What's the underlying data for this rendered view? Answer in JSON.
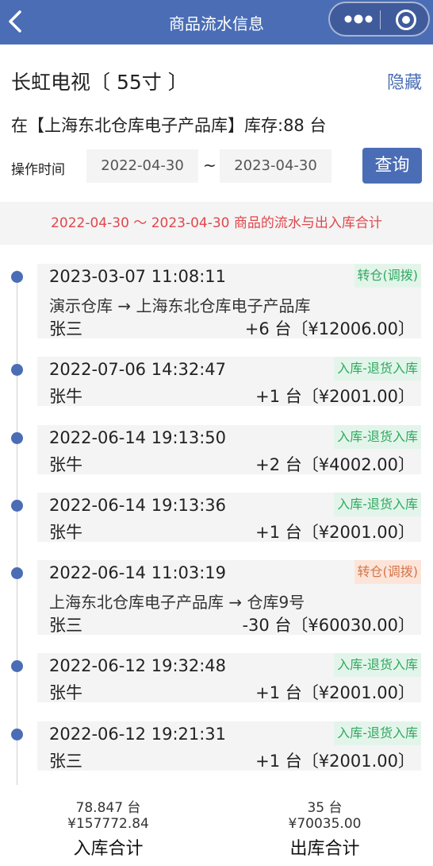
{
  "nav": {
    "title": "商品流水信息"
  },
  "product": {
    "name": "长虹电视〔 55寸 〕",
    "hide_label": "隐藏"
  },
  "location": {
    "text": "在【上海东北仓库电子产品库】库存:88 台"
  },
  "filter": {
    "op_time_label": "操作时间",
    "start_date": "2022-04-30",
    "separator": "~",
    "end_date": "2023-04-30",
    "query_label": "查询"
  },
  "banner": {
    "text": "2022-04-30 ～ 2023-04-30 商品的流水与出入库合计"
  },
  "records": [
    {
      "time": "2023-03-07 11:08:11",
      "tag": "转仓(调拨)",
      "route": "演示仓库 → 上海东北仓库电子产品库",
      "person": "张三",
      "amount": "+6 台〔¥12006.00〕"
    },
    {
      "time": "2022-07-06 14:32:47",
      "tag": "入库-退货入库",
      "person": "张牛",
      "amount": "+1 台〔¥2001.00〕"
    },
    {
      "time": "2022-06-14 19:13:50",
      "tag": "入库-退货入库",
      "person": "张牛",
      "amount": "+2 台〔¥4002.00〕"
    },
    {
      "time": "2022-06-14 19:13:36",
      "tag": "入库-退货入库",
      "person": "张牛",
      "amount": "+1 台〔¥2001.00〕"
    },
    {
      "time": "2022-06-14 11:03:19",
      "tag": "转仓(调拨)",
      "route": "上海东北仓库电子产品库 → 仓库9号",
      "person": "张三",
      "amount": "-30 台〔¥60030.00〕"
    },
    {
      "time": "2022-06-12 19:32:48",
      "tag": "入库-退货入库",
      "person": "张牛",
      "amount": "+1 台〔¥2001.00〕"
    },
    {
      "time": "2022-06-12 19:21:31",
      "tag": "入库-退货入库",
      "person": "张三",
      "amount": "+1 台〔¥2001.00〕"
    }
  ],
  "footer": {
    "in_qty": "78.847 台",
    "in_amount": "¥157772.84",
    "in_label": "入库合计",
    "out_qty": "35 台",
    "out_amount": "¥70035.00",
    "out_label": "出库合计"
  },
  "colors": {
    "primary": "#4a6db5",
    "alert": "#e0474c",
    "tag_green": "#30a860",
    "tag_orange": "#d2764a"
  }
}
